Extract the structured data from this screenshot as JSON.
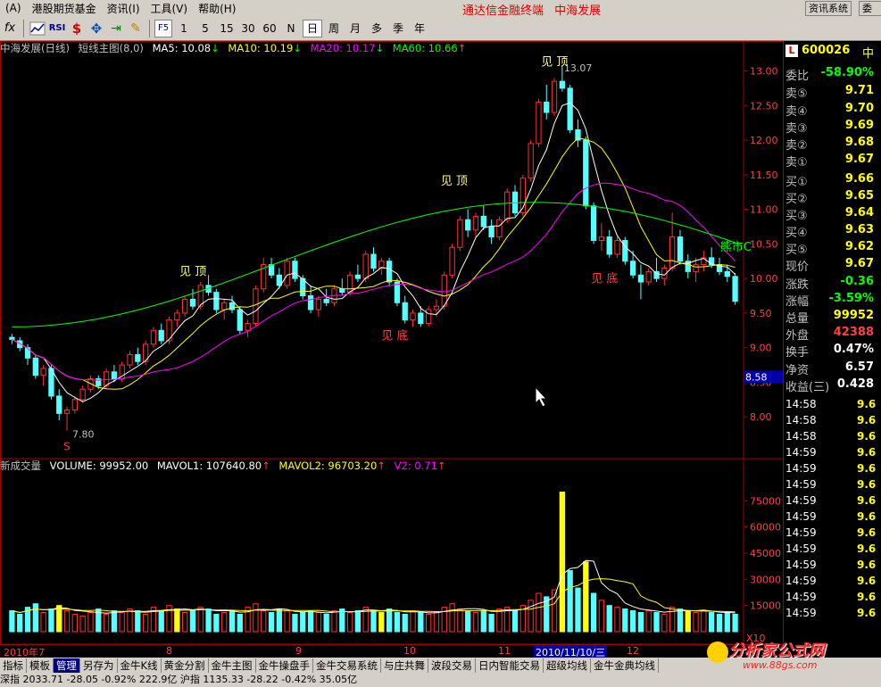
{
  "menu": {
    "items": [
      "(A)",
      "港股期货基金",
      "资讯(I)",
      "工具(V)",
      "帮助(H)"
    ],
    "center_title": [
      "通达信金融终端",
      "中海发展"
    ],
    "sys_button": "资讯系统",
    "sys_button2": "委托"
  },
  "toolbar": {
    "icons": [
      "fx-icon",
      "line-chart-icon",
      "rsi-icon",
      "dollar-icon",
      "move-icon",
      "export-icon",
      "pencil-icon"
    ],
    "rsi_label": "RSI",
    "f5_label": "F5",
    "periods": [
      "1",
      "5",
      "15",
      "30",
      "60",
      "N",
      "日",
      "周",
      "月",
      "多",
      "季",
      "年"
    ],
    "selected_period": "日"
  },
  "chart_header": {
    "title": "中海发展(日线)",
    "indicator": "短线主图(8,0)",
    "ma5": "MA5: 10.08",
    "ma10": "MA10: 10.19",
    "ma20": "MA20: 10.17",
    "ma60": "MA60: 10.66",
    "colors": {
      "ma5": "#ffffff",
      "ma10": "#ffff00",
      "ma20": "#ff00ff",
      "ma60": "#00ff00"
    }
  },
  "vol_header": {
    "name": "新成交量",
    "volume": "VOLUME: 99952.00",
    "mavol1": "MAVOL1: 107640.80",
    "mavol2": "MAVOL2: 96703.20",
    "v2": "V2: 0.71"
  },
  "annotations": {
    "top1": "见 顶",
    "top2": "见 顶",
    "top3": "见 顶",
    "bottom1": "见 底",
    "bottom2": "见 底",
    "high_label": "13.07",
    "low_label": "7.80",
    "bear_label": "熊市C",
    "cursor_price": "8.58",
    "signal_s": "S"
  },
  "price_axis": {
    "labels": [
      "13.00",
      "12.50",
      "12.00",
      "11.50",
      "11.00",
      "10.50",
      "10.00",
      "9.50",
      "9.00",
      "8.50",
      "8.00"
    ]
  },
  "vol_axis": {
    "labels": [
      "75000",
      "60000",
      "45000",
      "30000",
      "15000"
    ],
    "unit": "X10"
  },
  "date_axis": {
    "labels": [
      "2010年7",
      "8",
      "9",
      "10",
      "11",
      "12"
    ],
    "selected": "2010/11/10/三"
  },
  "quote": {
    "code": "600026",
    "name": "中",
    "rows": [
      {
        "label": "委比",
        "value": "-58.90%",
        "color": "#00ff00"
      },
      {
        "label": "卖⑤",
        "value": "9.71",
        "color": "#ffff00"
      },
      {
        "label": "卖④",
        "value": "9.70",
        "color": "#ffff00"
      },
      {
        "label": "卖③",
        "value": "9.69",
        "color": "#ffff00"
      },
      {
        "label": "卖②",
        "value": "9.68",
        "color": "#ffff00"
      },
      {
        "label": "卖①",
        "value": "9.67",
        "color": "#ffff00"
      },
      {
        "label": "买①",
        "value": "9.66",
        "color": "#ffff00"
      },
      {
        "label": "买②",
        "value": "9.65",
        "color": "#ffff00"
      },
      {
        "label": "买③",
        "value": "9.64",
        "color": "#ffff00"
      },
      {
        "label": "买④",
        "value": "9.63",
        "color": "#ffff00"
      },
      {
        "label": "买⑤",
        "value": "9.62",
        "color": "#ffff00"
      },
      {
        "label": "现价",
        "value": "9.67",
        "color": "#ffff00"
      },
      {
        "label": "涨跌",
        "value": "-0.36",
        "color": "#00ff00"
      },
      {
        "label": "涨幅",
        "value": "-3.59%",
        "color": "#00ff00"
      },
      {
        "label": "总量",
        "value": "99952",
        "color": "#ffff00"
      },
      {
        "label": "外盘",
        "value": "42388",
        "color": "#ff4040"
      },
      {
        "label": "换手",
        "value": "0.47%",
        "color": "#ffffff"
      },
      {
        "label": "净资",
        "value": "6.57",
        "color": "#ffffff"
      },
      {
        "label": "收益(三)",
        "value": "0.428",
        "color": "#ffffff"
      }
    ],
    "ticks": [
      {
        "time": "14:58",
        "price": "9.6"
      },
      {
        "time": "14:58",
        "price": "9.6"
      },
      {
        "time": "14:58",
        "price": "9.6"
      },
      {
        "time": "14:59",
        "price": "9.6"
      },
      {
        "time": "14:59",
        "price": "9.6"
      },
      {
        "time": "14:59",
        "price": "9.6"
      },
      {
        "time": "14:59",
        "price": "9.6"
      },
      {
        "time": "14:59",
        "price": "9.6"
      },
      {
        "time": "14:59",
        "price": "9.6"
      },
      {
        "time": "14:59",
        "price": "9.6"
      },
      {
        "time": "14:59",
        "price": "9.6"
      },
      {
        "time": "14:59",
        "price": "9.6"
      },
      {
        "time": "14:59",
        "price": "9.6"
      },
      {
        "time": "14:59",
        "price": "9.6"
      }
    ]
  },
  "bottom_tabs": [
    "指标",
    "模板",
    "管理",
    "另存为",
    "金牛K线",
    "黄金分割",
    "金牛主图",
    "金牛操盘手",
    "金牛交易系统",
    "与庄共舞",
    "波段交易",
    "日内智能交易",
    "超级均线",
    "金牛金典均线"
  ],
  "active_tab": "管理",
  "status_text": "深指 2033.71 -28.05 -0.92% 222.9亿 沪指 1135.33 -28.22 -0.42% 35.05亿",
  "watermark": {
    "big": "分析家公式网",
    "small": "www.88gs.com"
  },
  "chart_data": {
    "type": "candlestick",
    "title": "中海发展(日线)",
    "ylim": [
      7.5,
      13.2
    ],
    "high": 13.07,
    "low": 7.8,
    "ohlc": [
      [
        9.15,
        9.2,
        9.05,
        9.12
      ],
      [
        9.1,
        9.15,
        8.95,
        9.0
      ],
      [
        9.0,
        9.05,
        8.75,
        8.85
      ],
      [
        8.85,
        8.9,
        8.55,
        8.6
      ],
      [
        8.6,
        8.75,
        8.45,
        8.7
      ],
      [
        8.7,
        8.75,
        8.25,
        8.3
      ],
      [
        8.3,
        8.4,
        7.95,
        8.05
      ],
      [
        8.05,
        8.15,
        7.8,
        8.1
      ],
      [
        8.1,
        8.3,
        8.05,
        8.25
      ],
      [
        8.25,
        8.45,
        8.2,
        8.4
      ],
      [
        8.4,
        8.6,
        8.35,
        8.55
      ],
      [
        8.55,
        8.6,
        8.4,
        8.45
      ],
      [
        8.45,
        8.7,
        8.4,
        8.65
      ],
      [
        8.65,
        8.75,
        8.5,
        8.55
      ],
      [
        8.55,
        8.8,
        8.5,
        8.75
      ],
      [
        8.75,
        8.95,
        8.7,
        8.9
      ],
      [
        8.9,
        9.0,
        8.75,
        8.8
      ],
      [
        8.8,
        9.1,
        8.75,
        9.05
      ],
      [
        9.05,
        9.3,
        9.0,
        9.25
      ],
      [
        9.25,
        9.35,
        9.05,
        9.1
      ],
      [
        9.1,
        9.45,
        9.05,
        9.4
      ],
      [
        9.4,
        9.55,
        9.3,
        9.5
      ],
      [
        9.5,
        9.75,
        9.45,
        9.7
      ],
      [
        9.7,
        9.85,
        9.55,
        9.6
      ],
      [
        9.6,
        9.95,
        9.55,
        9.9
      ],
      [
        9.9,
        10.05,
        9.75,
        9.8
      ],
      [
        9.8,
        9.85,
        9.5,
        9.55
      ],
      [
        9.55,
        9.7,
        9.4,
        9.65
      ],
      [
        9.65,
        9.75,
        9.5,
        9.55
      ],
      [
        9.55,
        9.6,
        9.2,
        9.25
      ],
      [
        9.25,
        9.4,
        9.15,
        9.35
      ],
      [
        9.35,
        9.9,
        9.3,
        9.85
      ],
      [
        9.85,
        10.3,
        9.8,
        10.2
      ],
      [
        10.2,
        10.3,
        10.0,
        10.05
      ],
      [
        10.05,
        10.15,
        9.85,
        9.9
      ],
      [
        9.9,
        10.3,
        9.85,
        10.25
      ],
      [
        10.25,
        10.3,
        9.95,
        10.0
      ],
      [
        10.0,
        10.05,
        9.7,
        9.75
      ],
      [
        9.75,
        9.9,
        9.5,
        9.55
      ],
      [
        9.55,
        9.75,
        9.45,
        9.7
      ],
      [
        9.7,
        9.85,
        9.6,
        9.65
      ],
      [
        9.65,
        9.9,
        9.6,
        9.85
      ],
      [
        9.85,
        10.0,
        9.75,
        9.8
      ],
      [
        9.8,
        10.1,
        9.75,
        10.05
      ],
      [
        10.05,
        10.2,
        9.95,
        10.0
      ],
      [
        10.0,
        10.4,
        9.95,
        10.35
      ],
      [
        10.35,
        10.45,
        10.1,
        10.15
      ],
      [
        10.15,
        10.3,
        10.05,
        10.25
      ],
      [
        10.25,
        10.3,
        9.9,
        9.95
      ],
      [
        9.95,
        10.0,
        9.6,
        9.65
      ],
      [
        9.65,
        9.75,
        9.35,
        9.4
      ],
      [
        9.4,
        9.55,
        9.3,
        9.5
      ],
      [
        9.5,
        9.6,
        9.3,
        9.35
      ],
      [
        9.35,
        9.6,
        9.3,
        9.55
      ],
      [
        9.55,
        9.7,
        9.45,
        9.6
      ],
      [
        9.6,
        10.1,
        9.55,
        10.05
      ],
      [
        10.05,
        10.5,
        10.0,
        10.45
      ],
      [
        10.45,
        10.9,
        10.4,
        10.85
      ],
      [
        10.85,
        11.0,
        10.6,
        10.7
      ],
      [
        10.7,
        10.95,
        10.6,
        10.9
      ],
      [
        10.9,
        11.05,
        10.7,
        10.75
      ],
      [
        10.75,
        10.85,
        10.5,
        10.6
      ],
      [
        10.6,
        10.9,
        10.55,
        10.85
      ],
      [
        10.85,
        11.3,
        10.8,
        11.25
      ],
      [
        11.25,
        11.35,
        10.9,
        10.95
      ],
      [
        10.95,
        11.5,
        10.9,
        11.45
      ],
      [
        11.45,
        12.0,
        11.4,
        11.95
      ],
      [
        11.95,
        12.6,
        11.9,
        12.55
      ],
      [
        12.55,
        12.8,
        12.3,
        12.4
      ],
      [
        12.4,
        12.9,
        12.35,
        12.85
      ],
      [
        12.85,
        13.07,
        12.7,
        12.75
      ],
      [
        12.75,
        12.8,
        12.1,
        12.15
      ],
      [
        12.15,
        12.3,
        11.9,
        12.0
      ],
      [
        12.0,
        12.05,
        11.0,
        11.05
      ],
      [
        11.05,
        11.1,
        10.5,
        10.55
      ],
      [
        10.55,
        10.8,
        10.4,
        10.6
      ],
      [
        10.6,
        10.7,
        10.3,
        10.35
      ],
      [
        10.35,
        10.6,
        10.3,
        10.55
      ],
      [
        10.55,
        10.6,
        10.2,
        10.25
      ],
      [
        10.25,
        10.4,
        10.0,
        10.05
      ],
      [
        10.05,
        10.2,
        9.7,
        9.95
      ],
      [
        9.95,
        10.15,
        9.9,
        10.1
      ],
      [
        10.1,
        10.3,
        9.95,
        10.0
      ],
      [
        10.0,
        10.2,
        9.9,
        10.15
      ],
      [
        10.15,
        10.95,
        10.1,
        10.6
      ],
      [
        10.6,
        10.7,
        10.2,
        10.25
      ],
      [
        10.25,
        10.35,
        10.0,
        10.1
      ],
      [
        10.1,
        10.3,
        9.95,
        10.2
      ],
      [
        10.2,
        10.4,
        10.1,
        10.3
      ],
      [
        10.3,
        10.45,
        10.15,
        10.2
      ],
      [
        10.2,
        10.3,
        10.05,
        10.1
      ],
      [
        10.1,
        10.2,
        9.95,
        10.03
      ],
      [
        10.03,
        10.08,
        9.62,
        9.67
      ]
    ],
    "volume": [
      12,
      10,
      14,
      16,
      11,
      13,
      15,
      12,
      10,
      9,
      11,
      13,
      10,
      12,
      11,
      13,
      12,
      10,
      14,
      12,
      15,
      13,
      11,
      12,
      14,
      13,
      10,
      11,
      12,
      10,
      14,
      16,
      12,
      11,
      13,
      12,
      10,
      11,
      12,
      11,
      10,
      12,
      13,
      11,
      12,
      14,
      12,
      11,
      13,
      11,
      10,
      12,
      11,
      10,
      11,
      14,
      16,
      13,
      12,
      11,
      12,
      10,
      13,
      14,
      12,
      15,
      18,
      22,
      20,
      24,
      80,
      35,
      25,
      40,
      22,
      18,
      15,
      14,
      13,
      12,
      11,
      12,
      11,
      10,
      14,
      13,
      12,
      11,
      12,
      11,
      10,
      11,
      10
    ]
  }
}
